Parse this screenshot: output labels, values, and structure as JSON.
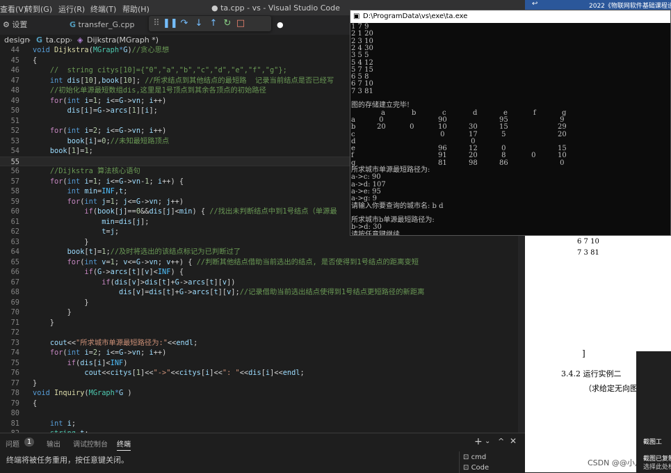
{
  "vscode": {
    "menu": [
      "查看(V)",
      "转到(G)",
      "运行(R)",
      "终端(T)",
      "帮助(H)"
    ],
    "window_title": "● ta.cpp - vs - Visual Studio Code",
    "tabs": {
      "settings": "设置",
      "transfer": "transfer_G.cpp",
      "ta_partial": "pp",
      "ta_count": "1"
    },
    "breadcrumb": {
      "folder": "design",
      "file": "ta.cpp",
      "symbol": "Dijkstra(MGraph *)"
    },
    "code_lines": [
      {
        "n": "44",
        "html": "<span class='kw'>void</span> <span class='fn'>Dijkstra</span>(<span class='ty'>MGraph</span><span class='kw'>*</span><span class='var'>G</span>)<span class='cm'>//贪心思想</span>"
      },
      {
        "n": "45",
        "html": "{"
      },
      {
        "n": "46",
        "html": "    <span class='cm'>//  string citys[10]={\"0\",\"a\",\"b\",\"c\",\"d\",\"e\",\"f\",\"g\"};</span>"
      },
      {
        "n": "47",
        "html": "    <span class='kw'>int</span> <span class='var'>dis</span>[<span class='num'>10</span>],<span class='var'>book</span>[<span class='num'>10</span>]; <span class='cm'>//所求结点到其他结点的最短路  记录当前结点是否已经写</span>"
      },
      {
        "n": "48",
        "html": "    <span class='cm'>//初始化单源最短数组dis,这里是1号顶点到其余各顶点的初始路径</span>"
      },
      {
        "n": "49",
        "html": "    <span class='ctl'>for</span>(<span class='kw'>int</span> <span class='var'>i</span>=<span class='num'>1</span>; <span class='var'>i</span>&lt;=<span class='var'>G</span>-&gt;<span class='var'>vn</span>; <span class='var'>i</span>++)"
      },
      {
        "n": "50",
        "html": "        <span class='var'>dis</span>[<span class='var'>i</span>]=<span class='var'>G</span>-&gt;<span class='var'>arcs</span>[<span class='num'>1</span>][<span class='var'>i</span>];"
      },
      {
        "n": "51",
        "html": ""
      },
      {
        "n": "52",
        "html": "    <span class='ctl'>for</span>(<span class='kw'>int</span> <span class='var'>i</span>=<span class='num'>2</span>; <span class='var'>i</span>&lt;=<span class='var'>G</span>-&gt;<span class='var'>vn</span>; <span class='var'>i</span>++)"
      },
      {
        "n": "53",
        "html": "        <span class='var'>book</span>[<span class='var'>i</span>]=<span class='num'>0</span>;<span class='cm'>//未知最短路顶点</span>"
      },
      {
        "n": "54",
        "html": "    <span class='var'>book</span>[<span class='num'>1</span>]=<span class='num'>1</span>;"
      },
      {
        "n": "55",
        "html": ""
      },
      {
        "n": "56",
        "html": "    <span class='cm'>//Dijkstra 算法核心语句</span>"
      },
      {
        "n": "57",
        "html": "    <span class='ctl'>for</span>(<span class='kw'>int</span> <span class='var'>i</span>=<span class='num'>1</span>; <span class='var'>i</span>&lt;=<span class='var'>G</span>-&gt;<span class='var'>vn</span>-<span class='num'>1</span>; <span class='var'>i</span>++) {"
      },
      {
        "n": "58",
        "html": "        <span class='kw'>int</span> <span class='var'>min</span>=<span class='mac'>INF</span>,<span class='var'>t</span>;"
      },
      {
        "n": "59",
        "html": "        <span class='ctl'>for</span>(<span class='kw'>int</span> <span class='var'>j</span>=<span class='num'>1</span>; <span class='var'>j</span>&lt;=<span class='var'>G</span>-&gt;<span class='var'>vn</span>; <span class='var'>j</span>++)"
      },
      {
        "n": "60",
        "html": "            <span class='ctl'>if</span>(<span class='var'>book</span>[<span class='var'>j</span>]==<span class='num'>0</span>&amp;&amp;<span class='var'>dis</span>[<span class='var'>j</span>]&lt;<span class='var'>min</span>) { <span class='cm'>//找出未判断结点中到1号结点（单源最</span>"
      },
      {
        "n": "61",
        "html": "                <span class='var'>min</span>=<span class='var'>dis</span>[<span class='var'>j</span>];"
      },
      {
        "n": "62",
        "html": "                <span class='var'>t</span>=<span class='var'>j</span>;"
      },
      {
        "n": "63",
        "html": "            }"
      },
      {
        "n": "64",
        "html": "        <span class='var'>book</span>[<span class='var'>t</span>]=<span class='num'>1</span>;<span class='cm'>//及时将选出的该结点标记为已判断过了</span>"
      },
      {
        "n": "65",
        "html": "        <span class='ctl'>for</span>(<span class='kw'>int</span> <span class='var'>v</span>=<span class='num'>1</span>; <span class='var'>v</span>&lt;=<span class='var'>G</span>-&gt;<span class='var'>vn</span>; <span class='var'>v</span>++) { <span class='cm'>//判断其他结点借助当前选出的结点, 是否使得到1号结点的距离变短</span>"
      },
      {
        "n": "66",
        "html": "            <span class='ctl'>if</span>(<span class='var'>G</span>-&gt;<span class='var'>arcs</span>[<span class='var'>t</span>][<span class='var'>v</span>]&lt;<span class='mac'>INF</span>) {"
      },
      {
        "n": "67",
        "html": "                <span class='ctl'>if</span>(<span class='var'>dis</span>[<span class='var'>v</span>]&gt;<span class='var'>dis</span>[<span class='var'>t</span>]+<span class='var'>G</span>-&gt;<span class='var'>arcs</span>[<span class='var'>t</span>][<span class='var'>v</span>])"
      },
      {
        "n": "68",
        "html": "                    <span class='var'>dis</span>[<span class='var'>v</span>]=<span class='var'>dis</span>[<span class='var'>t</span>]+<span class='var'>G</span>-&gt;<span class='var'>arcs</span>[<span class='var'>t</span>][<span class='var'>v</span>];<span class='cm'>//记录借助当前选出结点使得到1号结点更短路径的新距离</span>"
      },
      {
        "n": "69",
        "html": "            }"
      },
      {
        "n": "70",
        "html": "        }"
      },
      {
        "n": "71",
        "html": "    }"
      },
      {
        "n": "72",
        "html": ""
      },
      {
        "n": "73",
        "html": "    <span class='var'>cout</span>&lt;&lt;<span class='str'>\"所求城市单源最短路径为:\"</span>&lt;&lt;<span class='var'>endl</span>;"
      },
      {
        "n": "74",
        "html": "    <span class='ctl'>for</span>(<span class='kw'>int</span> <span class='var'>i</span>=<span class='num'>2</span>; <span class='var'>i</span>&lt;=<span class='var'>G</span>-&gt;<span class='var'>vn</span>; <span class='var'>i</span>++)"
      },
      {
        "n": "75",
        "html": "        <span class='ctl'>if</span>(<span class='var'>dis</span>[<span class='var'>i</span>]&lt;<span class='mac'>INF</span>)"
      },
      {
        "n": "76",
        "html": "            <span class='var'>cout</span>&lt;&lt;<span class='var'>citys</span>[<span class='num'>1</span>]&lt;&lt;<span class='str'>\"-&gt;\"</span>&lt;&lt;<span class='var'>citys</span>[<span class='var'>i</span>]&lt;&lt;<span class='str'>\": \"</span>&lt;&lt;<span class='var'>dis</span>[<span class='var'>i</span>]&lt;&lt;<span class='var'>endl</span>;"
      },
      {
        "n": "77",
        "html": "}"
      },
      {
        "n": "78",
        "html": "<span class='kw'>void</span> <span class='fn'>Inquiry</span>(<span class='ty'>MGraph</span><span class='kw'>*</span><span class='var'>G</span> )"
      },
      {
        "n": "79",
        "html": "{"
      },
      {
        "n": "80",
        "html": ""
      },
      {
        "n": "81",
        "html": "    <span class='kw'>int</span> <span class='var'>i</span>;"
      },
      {
        "n": "82",
        "html": "    <span class='ty'>string</span> <span class='var'>t</span>;"
      }
    ],
    "panel": {
      "tabs": [
        "问题",
        "输出",
        "调试控制台",
        "终端"
      ],
      "problems_count": "1",
      "terminal_text": "终端将被任务重用，按任意键关闭。",
      "side_items": [
        "cmd",
        "Code"
      ]
    }
  },
  "console": {
    "title": "D:\\ProgramData\\vs\\exe\\ta.exe",
    "lines": [
      "1 7 9",
      "2 1 20",
      "2 3 10",
      "2 4 30",
      "3 5 5",
      "5 4 12",
      "5 7 15",
      "6 5 8",
      "6 7 10",
      "7 3 81",
      "",
      "图的存储建立完毕!"
    ],
    "matrix_header": [
      "a",
      "b",
      "c",
      "d",
      "e",
      "f",
      "g"
    ],
    "matrix_rows": [
      {
        "label": "a",
        "cells": [
          "0",
          "",
          "90",
          "",
          "95",
          "",
          "9"
        ]
      },
      {
        "label": "b",
        "cells": [
          "20",
          "0",
          "10",
          "30",
          "15",
          "",
          "29"
        ]
      },
      {
        "label": "c",
        "cells": [
          "",
          "",
          "0",
          "17",
          "5",
          "",
          "20"
        ]
      },
      {
        "label": "d",
        "cells": [
          "",
          "",
          "",
          "0",
          "",
          "",
          ""
        ]
      },
      {
        "label": "e",
        "cells": [
          "",
          "",
          "96",
          "12",
          "0",
          "",
          "15"
        ]
      },
      {
        "label": "f",
        "cells": [
          "",
          "",
          "91",
          "20",
          "8",
          "0",
          "10"
        ]
      },
      {
        "label": "g",
        "cells": [
          "",
          "",
          "81",
          "98",
          "86",
          "",
          "0"
        ]
      }
    ],
    "after": [
      "所求城市单源最短路径为:",
      "a->c: 90",
      "a->d: 107",
      "a->e: 95",
      "a->g: 9",
      "请输入你要查询的城市名: b d",
      "",
      "所求城市b单源最短路径为:",
      "b->d: 30",
      "请按任意键继续. . ."
    ]
  },
  "background": {
    "top_title": "2022《物联网软件基础课程设",
    "doc_lines": [
      "6 7 10",
      "7 3 81"
    ],
    "doc_bracket": "]",
    "doc_heading": "3.4.2  运行实例二",
    "doc_sub": "（求给定无向图",
    "watermark": "CSDN @@小月@",
    "thumb_text": "截图工",
    "thumb_text2": "截图已复制",
    "thumb_text3": "选择此处标"
  }
}
